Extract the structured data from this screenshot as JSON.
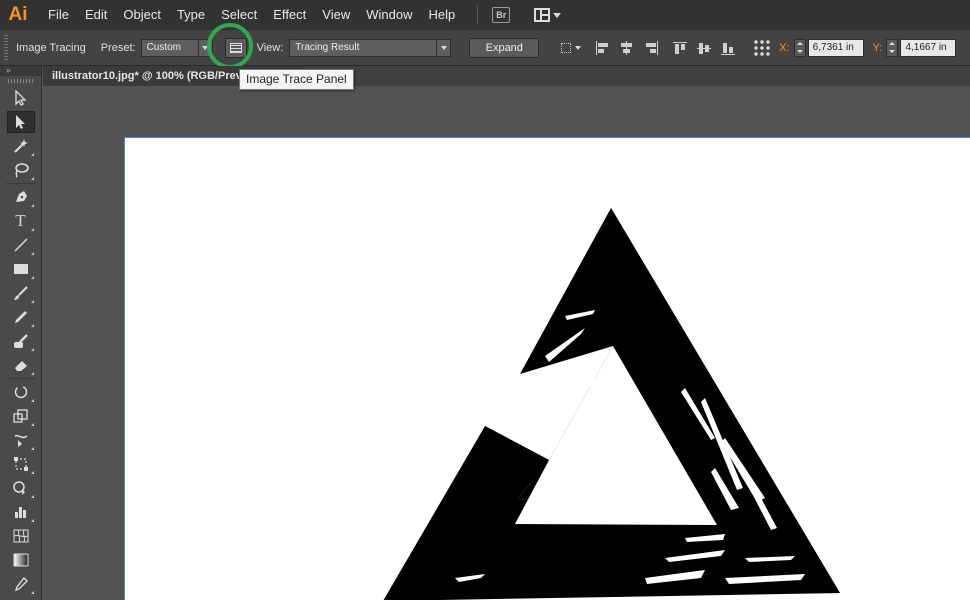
{
  "app": {
    "logo": "Ai"
  },
  "menu": {
    "items": [
      "File",
      "Edit",
      "Object",
      "Type",
      "Select",
      "Effect",
      "View",
      "Window",
      "Help"
    ],
    "bridge_label": "Br"
  },
  "control_bar": {
    "mode_label": "Image Tracing",
    "preset_label": "Preset:",
    "preset_value": "Custom",
    "view_label": "View:",
    "view_value": "Tracing Result",
    "expand_label": "Expand",
    "x_label": "X:",
    "x_value": "6,7361 in",
    "y_label": "Y:",
    "y_value": "4,1667 in"
  },
  "tooltip": {
    "text": "Image Trace Panel"
  },
  "document": {
    "tab_title": "illustrator10.jpg* @ 100% (RGB/Prev"
  },
  "tools": [
    "selection-tool",
    "direct-selection-tool",
    "magic-wand-tool",
    "lasso-tool",
    "pen-tool",
    "type-tool",
    "line-tool",
    "rectangle-tool",
    "paintbrush-tool",
    "pencil-tool",
    "blob-brush-tool",
    "eraser-tool",
    "rotate-tool",
    "scale-tool",
    "warp-tool",
    "free-transform-tool",
    "shape-builder-tool",
    "graph-tool",
    "mesh-tool",
    "gradient-tool",
    "eyedropper-tool"
  ],
  "colors": {
    "accent": "#f7941d",
    "highlight_ring": "#2fa84f"
  }
}
